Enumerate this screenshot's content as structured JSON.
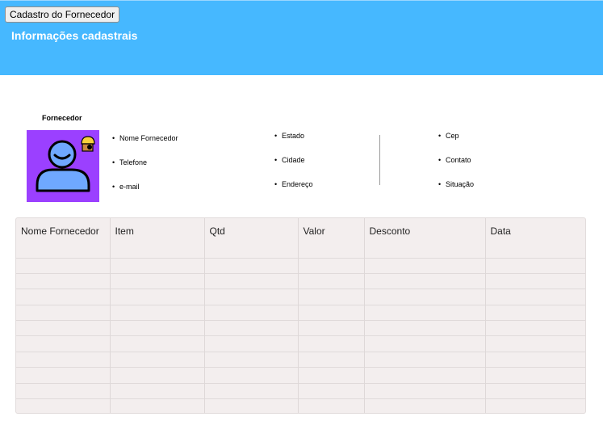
{
  "header": {
    "button_label": "Cadastro do Fornecedor",
    "title": "Informações cadastrais",
    "background_color": "#46b8ff"
  },
  "supplier": {
    "label": "Fornecedor",
    "avatar_icon": "supplier-worker-icon",
    "avatar_color": "#9b40ff"
  },
  "info": {
    "col1": [
      "Nome Fornecedor",
      "Telefone",
      "e-mail"
    ],
    "col2": [
      "Estado",
      "Cidade",
      "Endereço"
    ],
    "col3": [
      "Cep",
      "Contato",
      "Situação"
    ]
  },
  "table": {
    "columns": [
      "Nome Fornecedor",
      "Item",
      "Qtd",
      "Valor",
      "Desconto",
      "Data"
    ],
    "rows": [
      [
        "",
        "",
        "",
        "",
        "",
        ""
      ],
      [
        "",
        "",
        "",
        "",
        "",
        ""
      ],
      [
        "",
        "",
        "",
        "",
        "",
        ""
      ],
      [
        "",
        "",
        "",
        "",
        "",
        ""
      ],
      [
        "",
        "",
        "",
        "",
        "",
        ""
      ],
      [
        "",
        "",
        "",
        "",
        "",
        ""
      ],
      [
        "",
        "",
        "",
        "",
        "",
        ""
      ],
      [
        "",
        "",
        "",
        "",
        "",
        ""
      ],
      [
        "",
        "",
        "",
        "",
        "",
        ""
      ],
      [
        "",
        "",
        "",
        "",
        "",
        ""
      ]
    ]
  }
}
